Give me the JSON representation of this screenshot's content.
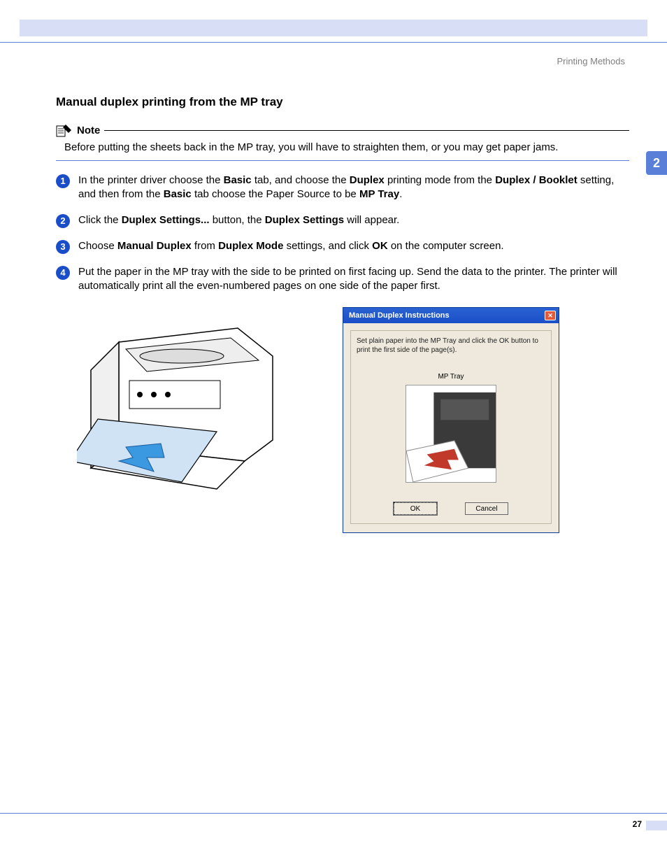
{
  "header": {
    "right": "Printing Methods"
  },
  "chapter_tab": "2",
  "section_title": "Manual duplex printing from the MP tray",
  "note": {
    "label": "Note",
    "body": "Before putting the sheets back in the MP tray, you will have to straighten them, or you may get paper jams."
  },
  "steps": [
    {
      "num": "1",
      "segments": [
        {
          "t": "In the printer driver choose the "
        },
        {
          "t": "Basic",
          "b": true
        },
        {
          "t": " tab, and choose the "
        },
        {
          "t": "Duplex",
          "b": true
        },
        {
          "t": " printing mode from the "
        },
        {
          "t": "Duplex / Booklet",
          "b": true
        },
        {
          "t": " setting, and then from the "
        },
        {
          "t": "Basic",
          "b": true
        },
        {
          "t": " tab choose the Paper Source to be "
        },
        {
          "t": "MP Tray",
          "b": true
        },
        {
          "t": "."
        }
      ]
    },
    {
      "num": "2",
      "segments": [
        {
          "t": "Click the "
        },
        {
          "t": "Duplex Settings...",
          "b": true
        },
        {
          "t": " button, the "
        },
        {
          "t": "Duplex Settings",
          "b": true
        },
        {
          "t": " will appear."
        }
      ]
    },
    {
      "num": "3",
      "segments": [
        {
          "t": "Choose "
        },
        {
          "t": "Manual Duplex",
          "b": true
        },
        {
          "t": " from "
        },
        {
          "t": "Duplex Mode",
          "b": true
        },
        {
          "t": " settings, and click "
        },
        {
          "t": "OK",
          "b": true
        },
        {
          "t": " on the computer screen."
        }
      ]
    },
    {
      "num": "4",
      "segments": [
        {
          "t": "Put the paper in the MP tray with the side to be printed on first facing up. Send the data to the printer. The printer will automatically print all the even-numbered pages on one side of the paper first."
        }
      ]
    }
  ],
  "dialog": {
    "title": "Manual Duplex Instructions",
    "message": "Set plain paper into the MP Tray and click the OK button to print the first side of the page(s).",
    "tray_label": "MP Tray",
    "ok": "OK",
    "cancel": "Cancel"
  },
  "page_number": "27"
}
